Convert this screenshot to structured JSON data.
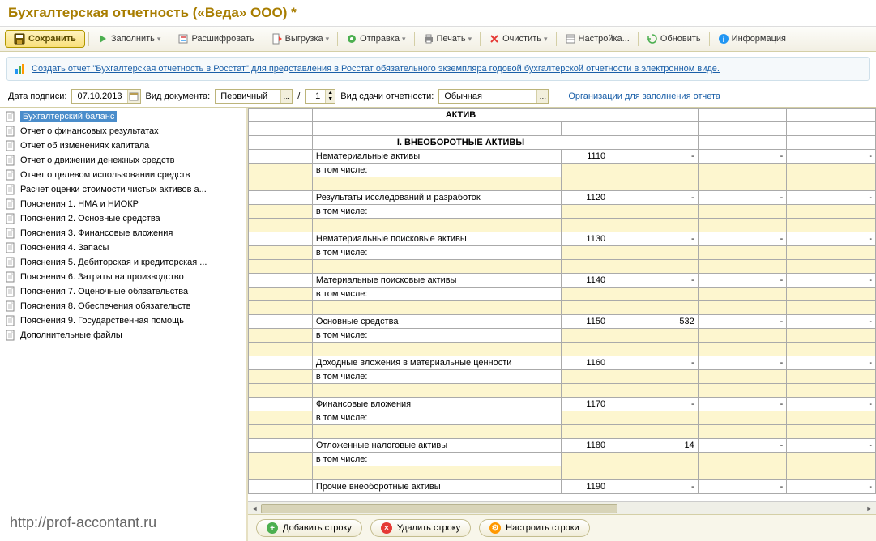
{
  "title": "Бухгалтерская отчетность («Веда» ООО) *",
  "toolbar": {
    "save": "Сохранить",
    "fill": "Заполнить",
    "decode": "Расшифровать",
    "export": "Выгрузка",
    "send": "Отправка",
    "print": "Печать",
    "clear": "Очистить",
    "settings": "Настройка...",
    "refresh": "Обновить",
    "info": "Информация"
  },
  "banner": {
    "text": "Создать отчет \"Бухгалтерская отчетность в Росстат\" для представления в Росстат обязательного экземпляра годовой бухгалтерской отчетности в электронном виде."
  },
  "form": {
    "date_label": "Дата подписи:",
    "date_value": "07.10.2013",
    "kind_label": "Вид документа:",
    "kind_value": "Первичный",
    "kind_sep": "/",
    "num_value": "1",
    "type_label": "Вид сдачи отчетности:",
    "type_value": "Обычная",
    "org_link": "Организации для заполнения отчета"
  },
  "sidebar": [
    "Бухгалтерский баланс",
    "Отчет о финансовых результатах",
    "Отчет об изменениях капитала",
    "Отчет о движении денежных средств",
    "Отчет о целевом использовании средств",
    "Расчет оценки стоимости чистых активов а...",
    "Пояснения 1. НМА и НИОКР",
    "Пояснения 2. Основные средства",
    "Пояснения 3. Финансовые вложения",
    "Пояснения 4. Запасы",
    "Пояснения 5. Дебиторская и кредиторская ...",
    "Пояснения 6. Затраты на производство",
    "Пояснения 7. Оценочные обязательства",
    "Пояснения 8. Обеспечения обязательств",
    "Пояснения 9. Государственная помощь",
    "Дополнительные файлы"
  ],
  "sheet": {
    "head1": "АКТИВ",
    "head2": "I. ВНЕОБОРОТНЫЕ АКТИВЫ",
    "including": "в том числе:",
    "rows": [
      {
        "name": "Нематериальные активы",
        "code": "1110",
        "v1": "-",
        "v2": "-",
        "v3": "-"
      },
      {
        "name": "Результаты исследований и разработок",
        "code": "1120",
        "v1": "-",
        "v2": "-",
        "v3": "-"
      },
      {
        "name": "Нематериальные поисковые активы",
        "code": "1130",
        "v1": "-",
        "v2": "-",
        "v3": "-"
      },
      {
        "name": "Материальные поисковые активы",
        "code": "1140",
        "v1": "-",
        "v2": "-",
        "v3": "-"
      },
      {
        "name": "Основные средства",
        "code": "1150",
        "v1": "532",
        "v2": "-",
        "v3": "-"
      },
      {
        "name": "Доходные вложения в материальные ценности",
        "code": "1160",
        "v1": "-",
        "v2": "-",
        "v3": "-"
      },
      {
        "name": "Финансовые вложения",
        "code": "1170",
        "v1": "-",
        "v2": "-",
        "v3": "-"
      },
      {
        "name": "Отложенные налоговые активы",
        "code": "1180",
        "v1": "14",
        "v2": "-",
        "v3": "-"
      },
      {
        "name": "Прочие внеоборотные активы",
        "code": "1190",
        "v1": "-",
        "v2": "-",
        "v3": "-"
      }
    ]
  },
  "bottom": {
    "add": "Добавить строку",
    "del": "Удалить строку",
    "cfg": "Настроить строки"
  },
  "watermark": "http://prof-accontant.ru"
}
